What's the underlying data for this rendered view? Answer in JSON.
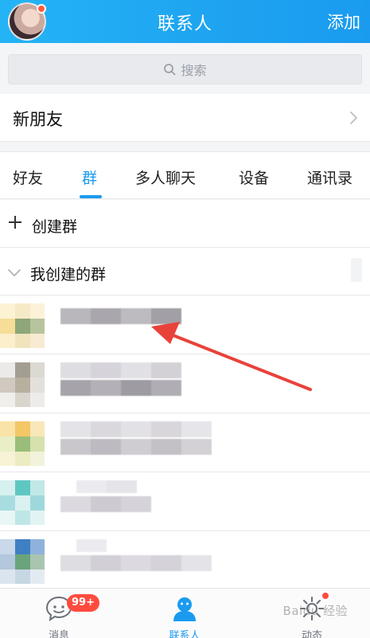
{
  "header": {
    "title": "联系人",
    "add_label": "添加"
  },
  "search": {
    "placeholder": "搜索"
  },
  "new_friends": {
    "label": "新朋友"
  },
  "tabs": [
    {
      "label": "好友",
      "active": false
    },
    {
      "label": "群",
      "active": true
    },
    {
      "label": "多人聊天",
      "active": false
    },
    {
      "label": "设备",
      "active": false
    },
    {
      "label": "通讯录",
      "active": false
    }
  ],
  "create_group": {
    "label": "创建群"
  },
  "my_groups": {
    "label": "我创建的群",
    "expanded": true
  },
  "bottom_nav": [
    {
      "label": "消息",
      "icon": "message-icon"
    },
    {
      "label": "联系人",
      "icon": "contacts-icon",
      "active": true
    },
    {
      "label": "动态",
      "icon": "moments-icon"
    }
  ],
  "badge": {
    "count": "99+"
  },
  "watermark": "Baidu 经验",
  "colors": {
    "accent": "#1a9bef",
    "badge": "#ff4b3e",
    "arrow": "#e8423a"
  }
}
